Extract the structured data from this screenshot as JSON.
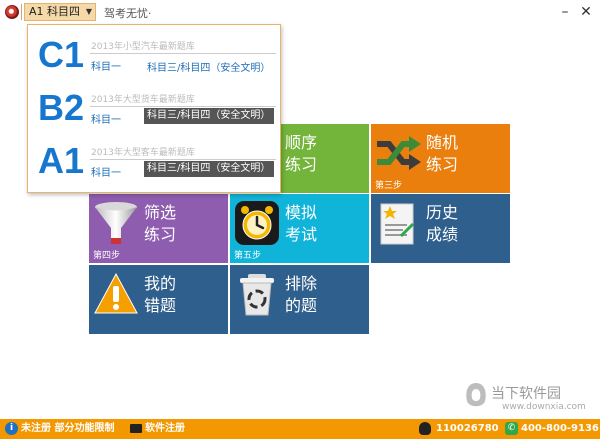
{
  "titlebar": {
    "course": "A1 科目四",
    "title": "驾考无忧·"
  },
  "dropdown": {
    "options": [
      {
        "code": "C1",
        "desc": "2013年小型汽车最新题库",
        "s1": "科目一",
        "s3": "科目三/科目四（安全文明）"
      },
      {
        "code": "B2",
        "desc": "2013年大型货车最新题库",
        "s1": "科目一",
        "s3": "科目三/科目四（安全文明）"
      },
      {
        "code": "A1",
        "desc": "2013年大型客车最新题库",
        "s1": "科目一",
        "s3": "科目三/科目四（安全文明）"
      }
    ]
  },
  "tiles": {
    "sequential": {
      "label": "顺序\n练习",
      "color": "#73b43a"
    },
    "random": {
      "label": "随机\n练习",
      "step": "第三步",
      "color": "#ea7f0e"
    },
    "filter": {
      "label": "筛选\n练习",
      "step": "第四步",
      "color": "#8e5db0"
    },
    "exam": {
      "label": "模拟\n考试",
      "step": "第五步",
      "color": "#11b4d9"
    },
    "history": {
      "label": "历史\n成绩",
      "color": "#2f5f8c"
    },
    "mistakes": {
      "label": "我的\n错题",
      "color": "#2f5f8c"
    },
    "excluded": {
      "label": "排除\n的题",
      "color": "#2f5f8c"
    }
  },
  "statusbar": {
    "unregistered": "未注册 部分功能限制",
    "register": "软件注册",
    "qq": "110026780",
    "phone": "400-800-9136"
  },
  "watermark": {
    "name": "当下软件园",
    "url": "www.downxia.com"
  }
}
